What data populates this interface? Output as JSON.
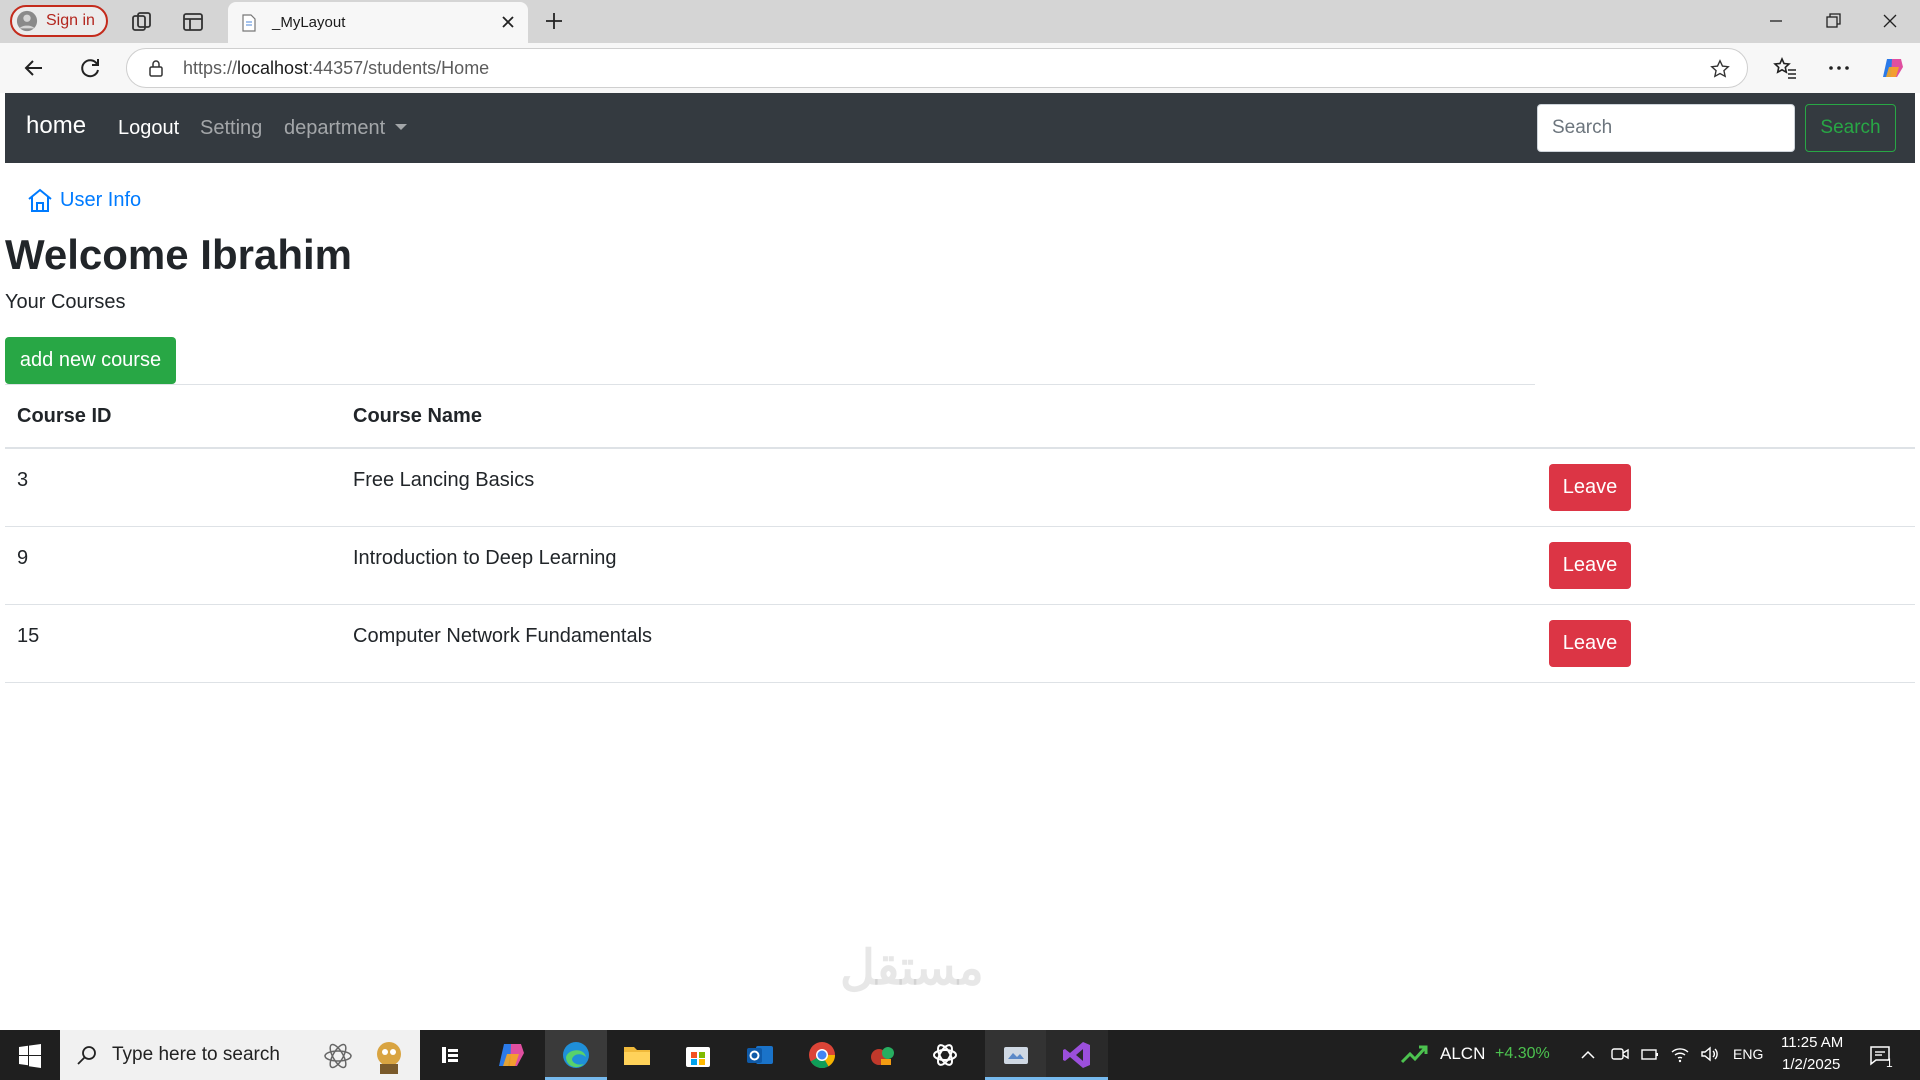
{
  "browser": {
    "signin_label": "Sign in",
    "tab_title": "_MyLayout",
    "url_prefix": "https://",
    "url_host": "localhost",
    "url_rest": ":44357/students/Home"
  },
  "navbar": {
    "brand": "home",
    "links": [
      "Logout",
      "Setting",
      "department"
    ],
    "search_placeholder": "Search",
    "search_button": "Search"
  },
  "main": {
    "user_info": "User Info",
    "welcome": "Welcome Ibrahim",
    "your_courses": "Your Courses",
    "add_button": "add new course",
    "table": {
      "headers": [
        "Course ID",
        "Course Name"
      ],
      "rows": [
        {
          "id": "3",
          "name": "Free Lancing Basics",
          "action": "Leave"
        },
        {
          "id": "9",
          "name": "Introduction to Deep Learning",
          "action": "Leave"
        },
        {
          "id": "15",
          "name": "Computer Network Fundamentals",
          "action": "Leave"
        }
      ]
    }
  },
  "watermark": "مستقل",
  "taskbar": {
    "search_text": "Type here to search",
    "stock_name": "ALCN",
    "stock_change": "+4.30%",
    "language": "ENG",
    "time": "11:25 AM",
    "date": "1/2/2025",
    "notification_count": "1"
  },
  "colors": {
    "navbar_bg": "#343a40",
    "success": "#28a745",
    "danger": "#dc3545",
    "link": "#007bff"
  },
  "icons": [
    "profile-icon",
    "workspaces-icon",
    "tab-actions-icon",
    "page-icon",
    "close-icon",
    "plus-icon",
    "minimize-icon",
    "restore-icon",
    "back-icon",
    "refresh-icon",
    "lock-icon",
    "star-icon",
    "favorites-icon",
    "more-icon",
    "copilot-icon",
    "home-icon",
    "windows-start-icon",
    "search-icon"
  ]
}
